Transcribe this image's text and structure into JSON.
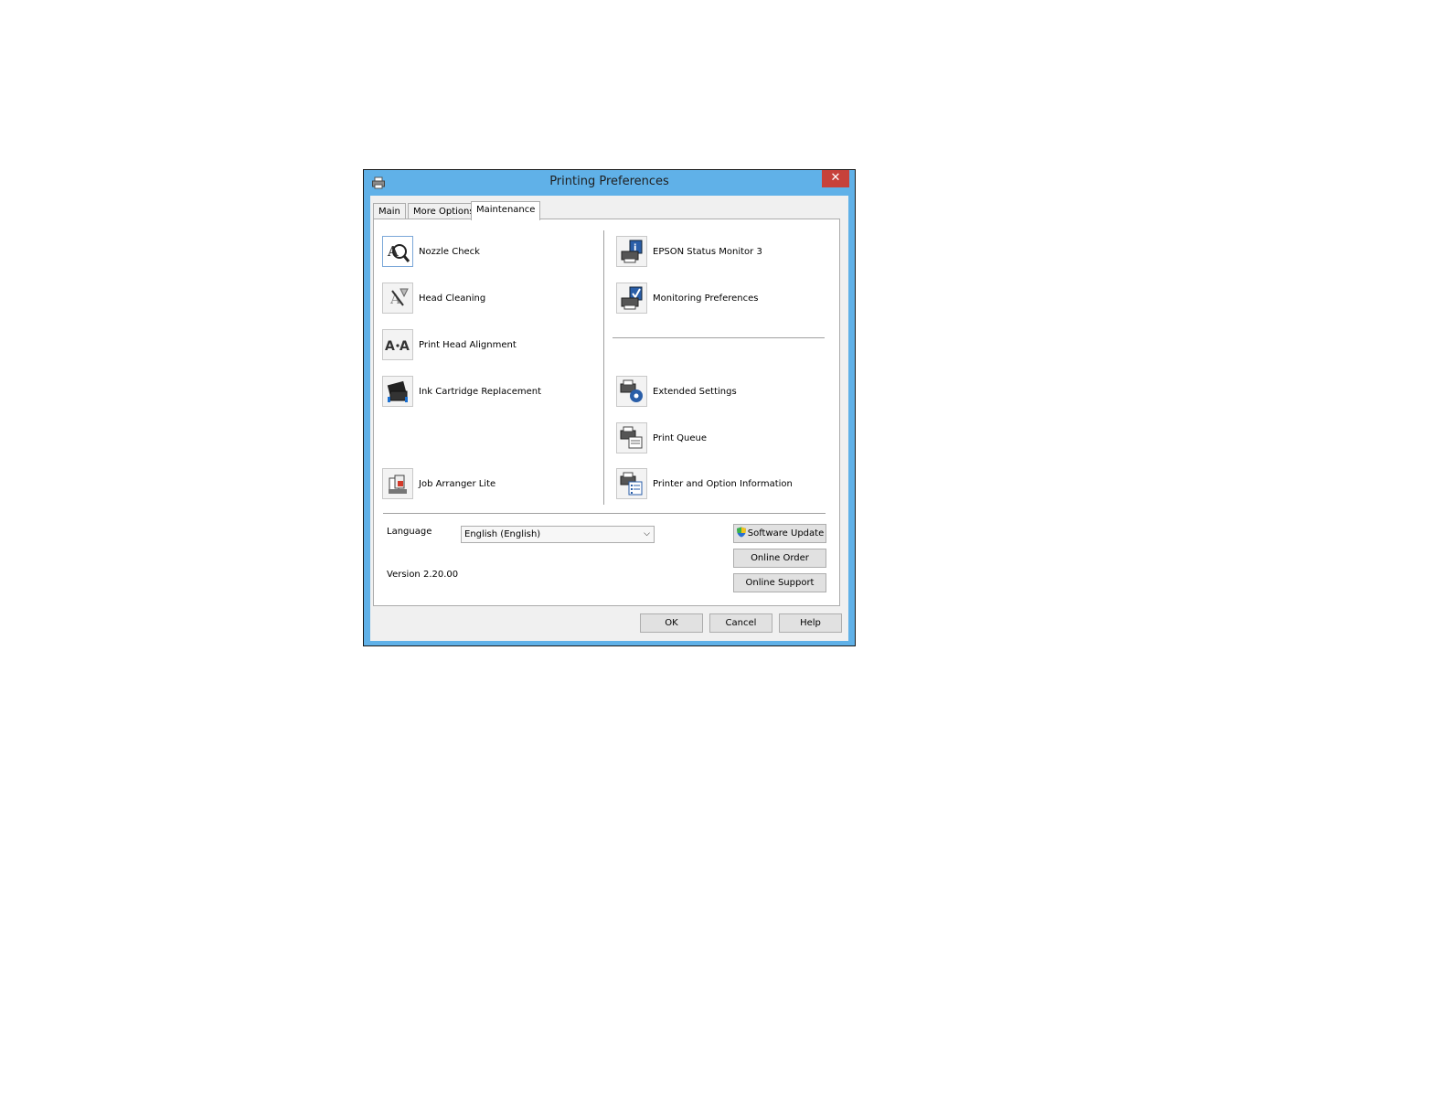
{
  "window": {
    "title": "Printing Preferences",
    "close_glyph": "✕",
    "title_icon": "printer-icon"
  },
  "tabs": [
    {
      "label": "Main",
      "active": false
    },
    {
      "label": "More Options",
      "active": false
    },
    {
      "label": "Maintenance",
      "active": true
    }
  ],
  "maintenance": {
    "left_items": [
      {
        "label": "Nozzle Check",
        "icon": "nozzle-check-icon"
      },
      {
        "label": "Head Cleaning",
        "icon": "head-cleaning-icon"
      },
      {
        "label": "Print Head Alignment",
        "icon": "print-head-alignment-icon"
      },
      {
        "label": "Ink Cartridge Replacement",
        "icon": "ink-cartridge-icon"
      },
      {
        "label": "Job Arranger Lite",
        "icon": "job-arranger-icon"
      }
    ],
    "right_items": [
      {
        "label": "EPSON Status Monitor 3",
        "icon": "status-monitor-icon"
      },
      {
        "label": "Monitoring Preferences",
        "icon": "monitoring-preferences-icon"
      },
      {
        "label": "Extended Settings",
        "icon": "extended-settings-icon"
      },
      {
        "label": "Print Queue",
        "icon": "print-queue-icon"
      },
      {
        "label": "Printer and Option Information",
        "icon": "printer-info-icon"
      }
    ]
  },
  "language": {
    "label": "Language",
    "selected": "English (English)"
  },
  "version": "Version 2.20.00",
  "side_buttons": {
    "software_update": "Software Update",
    "online_order": "Online Order",
    "online_support": "Online Support"
  },
  "footer_buttons": {
    "ok": "OK",
    "cancel": "Cancel",
    "help": "Help"
  },
  "colors": {
    "window_frame": "#60b1e8",
    "close_button": "#c7413a",
    "dialog_bg": "#f0f0f0"
  }
}
